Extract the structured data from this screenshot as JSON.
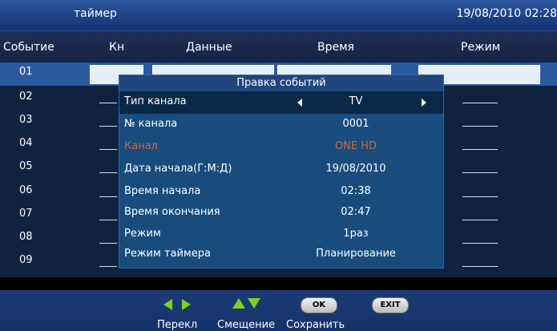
{
  "topbar": {
    "title": "таймер",
    "datetime": "19/08/2010 02:28"
  },
  "header": {
    "col_event": "Событие",
    "col_channel": "Кн",
    "col_data": "Данные",
    "col_time": "Время",
    "col_mode": "Режим"
  },
  "rows": [
    "01",
    "02",
    "03",
    "04",
    "05",
    "06",
    "07",
    "08",
    "09"
  ],
  "dialog": {
    "title": "Правка событий",
    "fields": [
      {
        "label": "Тип канала",
        "value": "TV"
      },
      {
        "label": "№ канала",
        "value": "0001"
      },
      {
        "label": "Канал",
        "value": "ONE HD"
      },
      {
        "label": "Дата начала(Г:М:Д)",
        "value": "19/08/2010"
      },
      {
        "label": "Время начала",
        "value": "02:38"
      },
      {
        "label": "Время окончания",
        "value": "02:47"
      },
      {
        "label": "Режим",
        "value": "1раз"
      },
      {
        "label": "Режим таймера",
        "value": "Планирование"
      }
    ]
  },
  "footer": {
    "switch_label": "Перекл",
    "move_label": "Смещение",
    "save_label": "Сохранить",
    "ok_button": "OK",
    "exit_button": "EXIT"
  },
  "colors": {
    "accent": "#2a5aa0",
    "dialog_bg": "#19508c",
    "disabled_text": "#cd6a3f",
    "icon_green": "#7ed321"
  }
}
